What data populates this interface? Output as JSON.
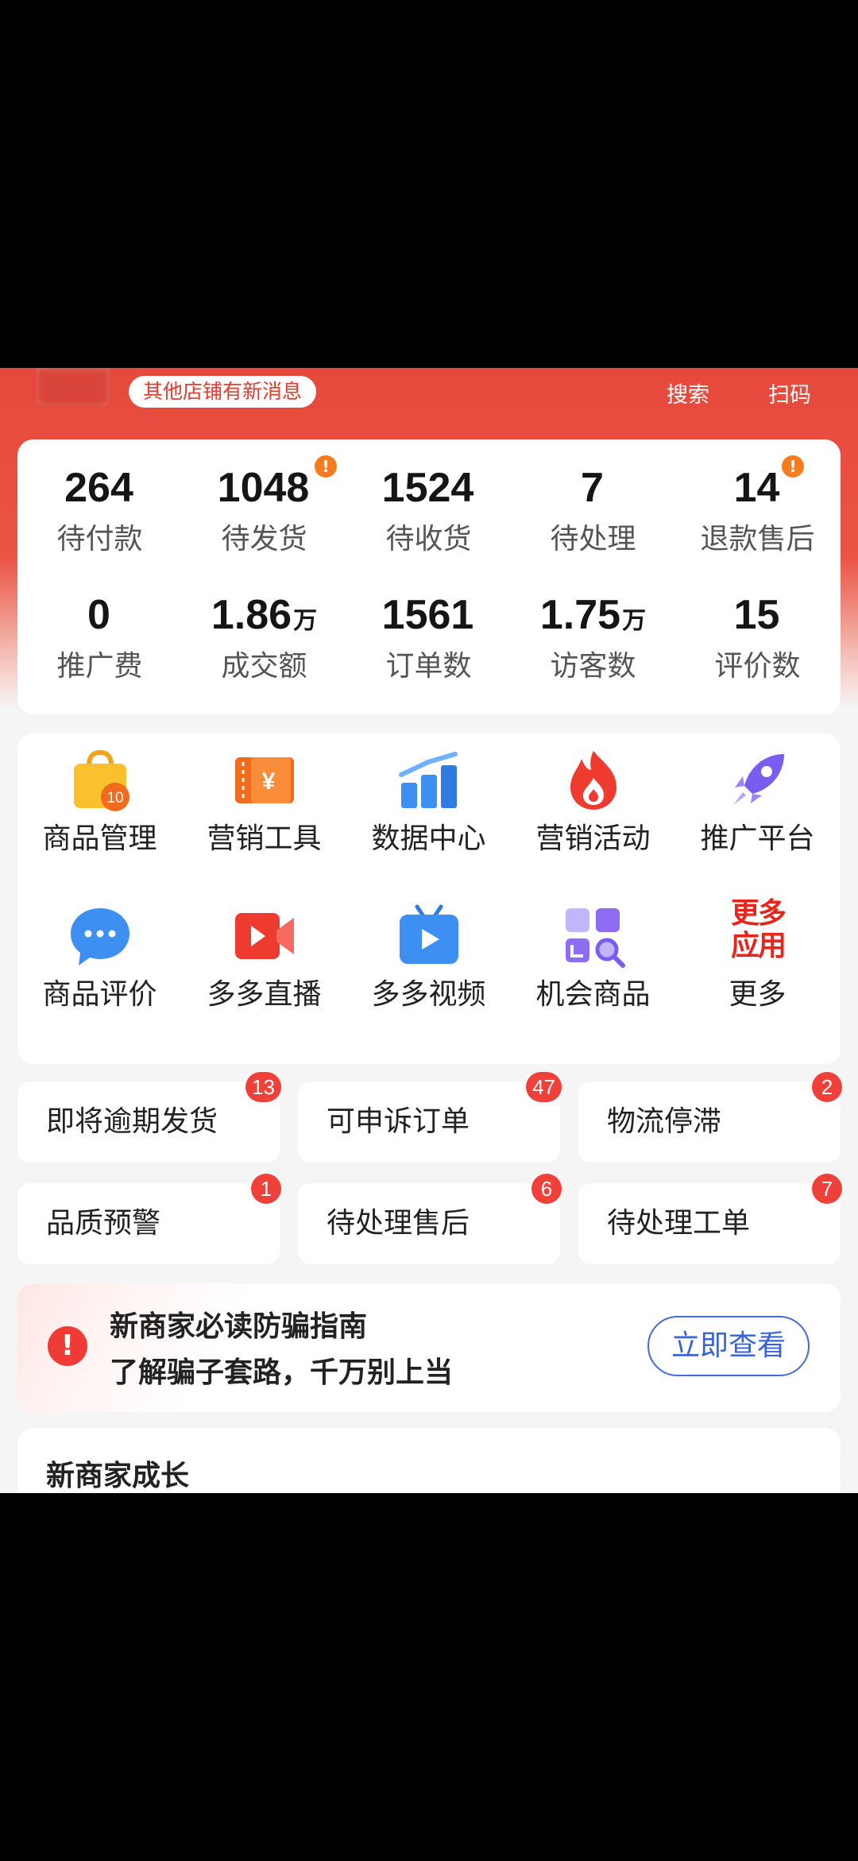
{
  "header": {
    "notice": "其他店铺有新消息",
    "search_label": "搜索",
    "scan_label": "扫码"
  },
  "stats": [
    {
      "value": "264",
      "unit": "",
      "label": "待付款",
      "alert": false
    },
    {
      "value": "1048",
      "unit": "",
      "label": "待发货",
      "alert": true
    },
    {
      "value": "1524",
      "unit": "",
      "label": "待收货",
      "alert": false
    },
    {
      "value": "7",
      "unit": "",
      "label": "待处理",
      "alert": false
    },
    {
      "value": "14",
      "unit": "",
      "label": "退款售后",
      "alert": true
    },
    {
      "value": "0",
      "unit": "",
      "label": "推广费",
      "alert": false
    },
    {
      "value": "1.86",
      "unit": "万",
      "label": "成交额",
      "alert": false
    },
    {
      "value": "1561",
      "unit": "",
      "label": "订单数",
      "alert": false
    },
    {
      "value": "1.75",
      "unit": "万",
      "label": "访客数",
      "alert": false
    },
    {
      "value": "15",
      "unit": "",
      "label": "评价数",
      "alert": false
    }
  ],
  "alert_glyph": "!",
  "apps": [
    {
      "label": "商品管理",
      "icon": "shopping-bag-icon",
      "icon_text": "10"
    },
    {
      "label": "营销工具",
      "icon": "coupon-icon",
      "icon_text": "¥"
    },
    {
      "label": "数据中心",
      "icon": "bar-chart-icon",
      "icon_text": ""
    },
    {
      "label": "营销活动",
      "icon": "flame-icon",
      "icon_text": ""
    },
    {
      "label": "推广平台",
      "icon": "rocket-icon",
      "icon_text": ""
    },
    {
      "label": "商品评价",
      "icon": "chat-bubble-icon",
      "icon_text": ""
    },
    {
      "label": "多多直播",
      "icon": "live-camera-icon",
      "icon_text": ""
    },
    {
      "label": "多多视频",
      "icon": "video-tv-icon",
      "icon_text": ""
    },
    {
      "label": "机会商品",
      "icon": "grid-search-icon",
      "icon_text": ""
    },
    {
      "label": "更多",
      "icon": "more-apps-icon",
      "icon_text": "更多应用"
    }
  ],
  "tasks": [
    {
      "label": "即将逾期发货",
      "badge": "13"
    },
    {
      "label": "可申诉订单",
      "badge": "47"
    },
    {
      "label": "物流停滞",
      "badge": "2"
    },
    {
      "label": "品质预警",
      "badge": "1"
    },
    {
      "label": "待处理售后",
      "badge": "6"
    },
    {
      "label": "待处理工单",
      "badge": "7"
    }
  ],
  "fraud": {
    "title": "新商家必读防骗指南",
    "subtitle": "了解骗子套路，千万别上当",
    "button": "立即查看",
    "icon_glyph": "!"
  },
  "growth": {
    "title": "新商家成长"
  },
  "colors": {
    "brand_red": "#e6493c",
    "badge_red": "#f0403a",
    "alert_orange": "#f57c1f",
    "link_blue": "#3a63d8"
  }
}
